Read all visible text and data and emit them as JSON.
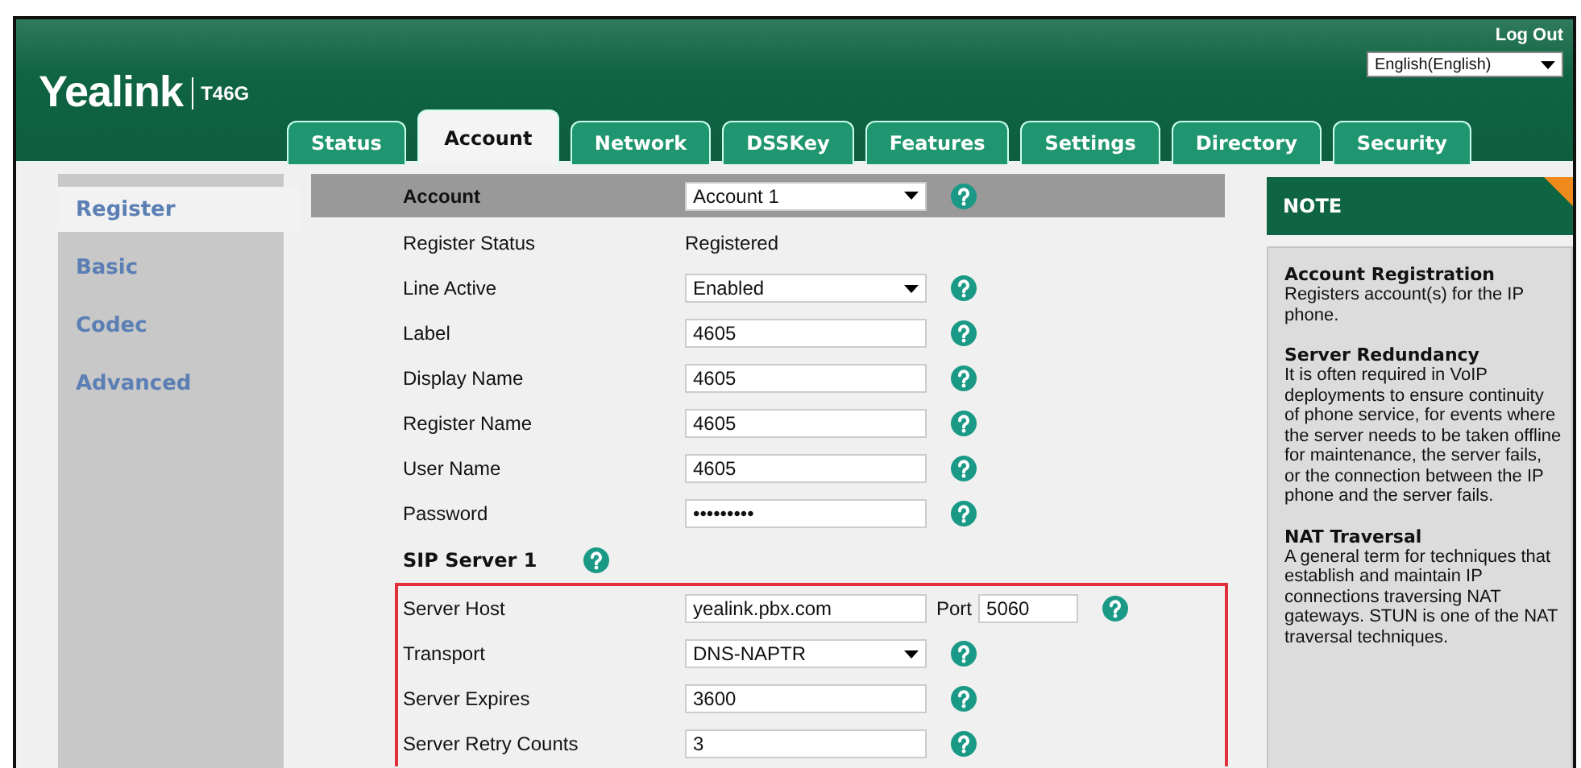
{
  "header": {
    "logo": "Yealink",
    "model": "T46G",
    "logout": "Log Out",
    "language": "English(English)"
  },
  "tabs": [
    {
      "label": "Status",
      "selected": false
    },
    {
      "label": "Account",
      "selected": true
    },
    {
      "label": "Network",
      "selected": false
    },
    {
      "label": "DSSKey",
      "selected": false
    },
    {
      "label": "Features",
      "selected": false
    },
    {
      "label": "Settings",
      "selected": false
    },
    {
      "label": "Directory",
      "selected": false
    },
    {
      "label": "Security",
      "selected": false
    }
  ],
  "sidebar": {
    "items": [
      {
        "label": "Register",
        "selected": true
      },
      {
        "label": "Basic",
        "selected": false
      },
      {
        "label": "Codec",
        "selected": false
      },
      {
        "label": "Advanced",
        "selected": false
      }
    ]
  },
  "form": {
    "header": {
      "label": "Account",
      "value": "Account 1"
    },
    "rows": [
      {
        "kind": "text",
        "label": "Register Status",
        "value": "Registered"
      },
      {
        "kind": "select",
        "label": "Line Active",
        "value": "Enabled"
      },
      {
        "kind": "input",
        "label": "Label",
        "value": "4605"
      },
      {
        "kind": "input",
        "label": "Display Name",
        "value": "4605"
      },
      {
        "kind": "input",
        "label": "Register Name",
        "value": "4605"
      },
      {
        "kind": "input",
        "label": "User Name",
        "value": "4605"
      },
      {
        "kind": "input",
        "label": "Password",
        "value": "•••••••••"
      }
    ],
    "section": {
      "title": "SIP Server 1",
      "rows": [
        {
          "kind": "host",
          "label": "Server Host",
          "value": "yealink.pbx.com",
          "port_label": "Port",
          "port": "5060"
        },
        {
          "kind": "select",
          "label": "Transport",
          "value": "DNS-NAPTR"
        },
        {
          "kind": "input",
          "label": "Server Expires",
          "value": "3600"
        },
        {
          "kind": "input",
          "label": "Server Retry Counts",
          "value": "3"
        }
      ]
    }
  },
  "note": {
    "title": "NOTE",
    "entries": [
      {
        "heading": "Account Registration",
        "text": "Registers account(s) for the IP phone."
      },
      {
        "heading": "Server Redundancy",
        "text": "It is often required in VoIP deployments to ensure continuity of phone service, for events where the server needs to be taken offline for maintenance, the server fails, or the connection between the IP phone and the server fails."
      },
      {
        "heading": "NAT Traversal",
        "text": "A general term for techniques that establish and maintain IP connections traversing NAT gateways. STUN is one of the NAT traversal techniques."
      }
    ]
  }
}
